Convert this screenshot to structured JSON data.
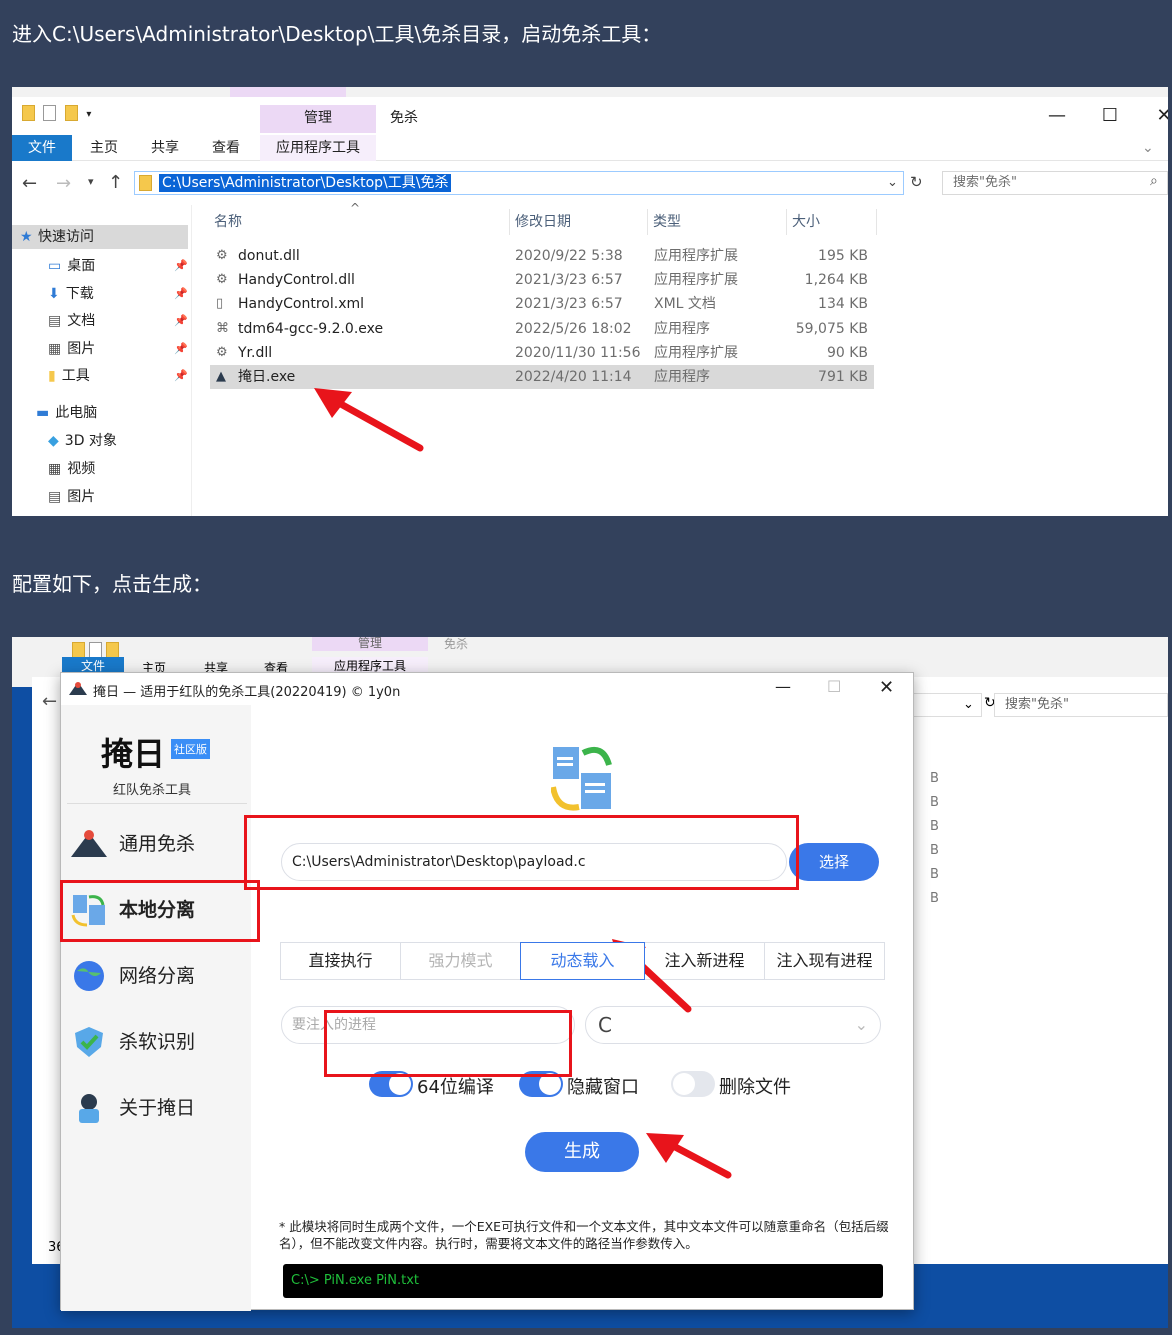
{
  "captions": {
    "step1": "进入C:\\Users\\Administrator\\Desktop\\工具\\免杀目录，启动免杀工具：",
    "step2": "配置如下，点击生成："
  },
  "explorer": {
    "manage_tab": "管理",
    "title": "免杀",
    "ribbon": {
      "file": "文件",
      "home": "主页",
      "share": "共享",
      "view": "查看",
      "app_tools": "应用程序工具"
    },
    "address": "C:\\Users\\Administrator\\Desktop\\工具\\免杀",
    "search_placeholder": "搜索\"免杀\"",
    "sidebar": {
      "quick_access": "快速访问",
      "items": [
        {
          "label": "桌面"
        },
        {
          "label": "下载"
        },
        {
          "label": "文档"
        },
        {
          "label": "图片"
        },
        {
          "label": "工具"
        }
      ],
      "this_pc": "此电脑",
      "pc_items": [
        {
          "label": "3D 对象"
        },
        {
          "label": "视频"
        },
        {
          "label": "图片"
        }
      ]
    },
    "columns": {
      "name": "名称",
      "date": "修改日期",
      "type": "类型",
      "size": "大小"
    },
    "files": [
      {
        "name": "donut.dll",
        "date": "2020/9/22 5:38",
        "type": "应用程序扩展",
        "size": "195 KB"
      },
      {
        "name": "HandyControl.dll",
        "date": "2021/3/23 6:57",
        "type": "应用程序扩展",
        "size": "1,264 KB"
      },
      {
        "name": "HandyControl.xml",
        "date": "2021/3/23 6:57",
        "type": "XML 文档",
        "size": "134 KB"
      },
      {
        "name": "tdm64-gcc-9.2.0.exe",
        "date": "2022/5/26 18:02",
        "type": "应用程序",
        "size": "59,075 KB"
      },
      {
        "name": "Yr.dll",
        "date": "2020/11/30 11:56",
        "type": "应用程序扩展",
        "size": "90 KB"
      },
      {
        "name": "掩日.exe",
        "date": "2022/4/20 11:14",
        "type": "应用程序",
        "size": "791 KB"
      }
    ]
  },
  "bg_window": {
    "manage_tab": "管理",
    "title": "免杀",
    "ribbon": {
      "file": "文件",
      "home": "主页",
      "share": "共享",
      "view": "查看",
      "app_tools": "应用程序工具"
    },
    "search_placeholder": "搜索\"免杀\"",
    "partial_text": "36"
  },
  "app": {
    "title": "掩日 — 适用于红队的免杀工具(20220419) © 1y0n",
    "brand": "掩日",
    "badge": "社区版",
    "subtitle": "红队免杀工具",
    "nav": [
      {
        "label": "通用免杀"
      },
      {
        "label": "本地分离"
      },
      {
        "label": "网络分离"
      },
      {
        "label": "杀软识别"
      },
      {
        "label": "关于掩日"
      }
    ],
    "file_path": "C:\\Users\\Administrator\\Desktop\\payload.c",
    "choose_button": "选择",
    "modes": [
      {
        "label": "直接执行"
      },
      {
        "label": "强力模式"
      },
      {
        "label": "动态载入"
      },
      {
        "label": "注入新进程"
      },
      {
        "label": "注入现有进程"
      }
    ],
    "selected_mode": "动态载入",
    "process_placeholder": "要注入的进程",
    "select_value": "C",
    "toggles": [
      {
        "label": "64位编译",
        "on": true
      },
      {
        "label": "隐藏窗口",
        "on": true
      },
      {
        "label": "删除文件",
        "on": false
      }
    ],
    "generate_button": "生成",
    "note": "* 此模块将同时生成两个文件，一个EXE可执行文件和一个文本文件，其中文本文件可以随意重命名（包括后缀名），但不能改变文件内容。执行时，需要将文本文件的路径当作参数传入。",
    "console": "C:\\> PiN.exe PiN.txt"
  },
  "colors": {
    "page_bg": "#33415c",
    "accent": "#3b82f6",
    "highlight": "#e8141b",
    "console_text": "#1fbf3a"
  }
}
